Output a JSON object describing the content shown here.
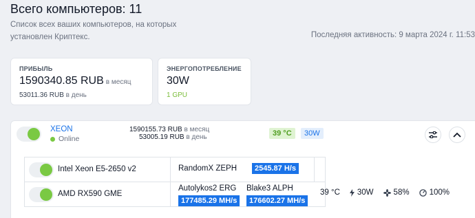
{
  "header": {
    "title": "Всего компьютеров: 11",
    "subtitle": "Список всех ваших компьютеров, на которых установлен Криптекс.",
    "last_activity": "Последняя активность: 9 марта 2024 г. 11:53"
  },
  "cards": {
    "profit": {
      "label": "ПРИБЫЛЬ",
      "value": "1590340.85 RUB",
      "value_unit": "в месяц",
      "sub_value": "53011.36 RUB",
      "sub_unit": "в день"
    },
    "energy": {
      "label": "ЭНЕРГОПОТРЕБЛЕНИЕ",
      "value": "30W",
      "sub_value": "1 GPU"
    }
  },
  "device": {
    "name": "XEON",
    "status": "Online",
    "month_value": "1590155.73 RUB",
    "month_unit": "в месяц",
    "day_value": "53005.19 RUB",
    "day_unit": "в день",
    "temp_badge": "39 °C",
    "power_badge": "30W",
    "hardware": [
      {
        "name": "Intel Xeon E5-2650 v2",
        "algo": "RandomX ZEPH",
        "hashrate": "2545.87 H/s"
      },
      {
        "name": "AMD RX590 GME",
        "algo1": "Autolykos2 ERG",
        "hashrate1": "177485.29 MH/s",
        "algo2": "Blake3 ALPH",
        "hashrate2": "176602.27 MH/s",
        "temp": "39 °C",
        "power": "30W",
        "fan": "58%",
        "load": "100%"
      }
    ]
  },
  "colors": {
    "accent": "#1a73e8",
    "online": "#7ac943",
    "temp_bg": "#dff3d2",
    "power_bg": "#e3eefc"
  }
}
